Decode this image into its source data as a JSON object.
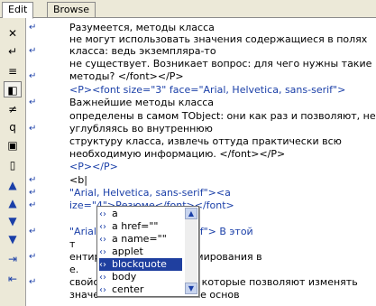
{
  "tabs": [
    "Edit",
    "Browse"
  ],
  "toolbar": [
    {
      "name": "close-icon",
      "glyph": "✕"
    },
    {
      "name": "paragraph-return-icon",
      "glyph": "↵"
    },
    {
      "name": "format-icon",
      "glyph": "≡"
    },
    {
      "name": "tag-bracket-icon",
      "glyph": "◧"
    },
    {
      "name": "special-char-icon",
      "glyph": "≠"
    },
    {
      "name": "find-icon",
      "glyph": "q"
    },
    {
      "name": "screen-icon",
      "glyph": "▣"
    },
    {
      "name": "page-icon",
      "glyph": "▯"
    },
    {
      "name": "move-top-icon",
      "glyph": "▲"
    },
    {
      "name": "move-up-icon",
      "glyph": "▲"
    },
    {
      "name": "move-down-icon",
      "glyph": "▼"
    },
    {
      "name": "move-bottom-icon",
      "glyph": "▼"
    },
    {
      "name": "indent-icon",
      "glyph": "⇥"
    },
    {
      "name": "outdent-icon",
      "glyph": "⇤"
    }
  ],
  "lines": [
    {
      "text": "Разумеется, методы класса",
      "blue": false
    },
    {
      "text": " не могут использовать значения  содержащиеся в полях",
      "blue": false
    },
    {
      "text": "класса: ведь экземпляра-то",
      "blue": false
    },
    {
      "text": " не существует. Возникает вопрос: для чего нужны такие",
      "blue": false
    },
    {
      "text": "методы? </font></P>",
      "blue": false
    },
    {
      "text": "<P><font size=\"3\" face=\"Arial, Helvetica, sans-serif\">",
      "blue": true
    },
    {
      "text": "Важнейшие методы класса",
      "blue": false
    },
    {
      "text": " определены в самом TObject: они как раз и позволяют, не",
      "blue": false
    },
    {
      "text": "углубляясь во внутреннюю",
      "blue": false
    },
    {
      "text": " структуру класса, извлечь оттуда практически всю",
      "blue": false
    },
    {
      "text": "необходимую информацию. </font></P>",
      "blue": false
    },
    {
      "text": "<P></P>",
      "blue": true
    },
    {
      "text": "<b|",
      "blue": false
    },
    {
      "text": "                \"Arial, Helvetica, sans-serif\"><a",
      "blue": true
    },
    {
      "text": "                ize=\"4\">Резюме</font></font>",
      "blue": true
    },
    {
      "text": "",
      "blue": false
    },
    {
      "text": "                \"Arial, Helvetica, sans-serif\"> В этой",
      "blue": true
    },
    {
      "text": "т",
      "blue": false
    },
    {
      "text": "                ентированного программирования в",
      "blue": false
    },
    {
      "text": "                е.",
      "blue": false
    },
    {
      "text": " свойствами и методами, которые позволяют изменять",
      "blue": false
    },
    {
      "text": "значения свойств. Знание основ",
      "blue": false
    }
  ],
  "popup": {
    "items": [
      "a",
      "a href=\"\"",
      "a name=\"\"",
      "applet",
      "blockquote",
      "body",
      "center"
    ],
    "selected": "blockquote"
  }
}
